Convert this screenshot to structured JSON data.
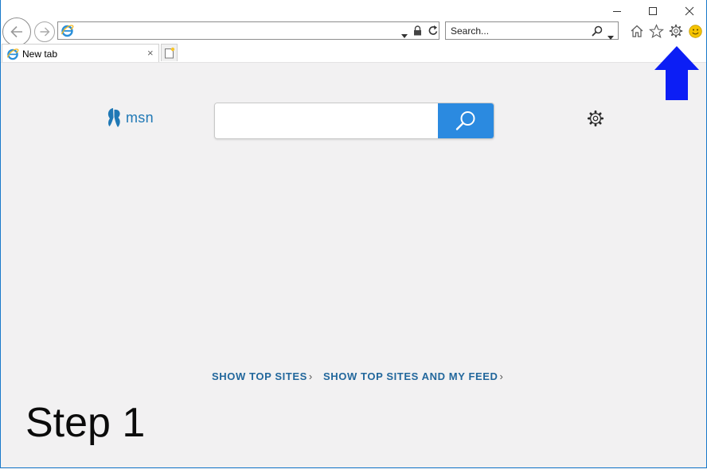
{
  "window": {
    "controls": [
      {
        "name": "minimize",
        "icon": "minimize-icon"
      },
      {
        "name": "maximize",
        "icon": "maximize-icon"
      },
      {
        "name": "close",
        "icon": "close-icon"
      }
    ]
  },
  "toolbar": {
    "address": {
      "value": "",
      "placeholder": ""
    },
    "search": {
      "value": "",
      "placeholder": "Search..."
    },
    "icons": [
      "back-arrow-icon",
      "forward-arrow-icon",
      "ie-logo-icon",
      "dropdown-icon",
      "lock-icon",
      "refresh-icon",
      "search-icon",
      "home-icon",
      "favorites-star-icon",
      "tools-gear-icon",
      "smiley-feedback-icon"
    ]
  },
  "tabs": [
    {
      "label": "New tab",
      "close": "×",
      "active": true
    }
  ],
  "content": {
    "logo_text": "msn",
    "search": {
      "value": "",
      "placeholder": ""
    },
    "links": [
      {
        "label": "SHOW TOP SITES",
        "chevron": "›"
      },
      {
        "label": "SHOW TOP SITES AND MY FEED",
        "chevron": "›"
      }
    ]
  },
  "overlay": {
    "step_label": "Step 1",
    "arrow_color": "#0c1ef5",
    "arrow_direction": "up"
  },
  "colors": {
    "accent": "#2b8ae0",
    "link": "#22679c",
    "window_border": "#1979ca",
    "page_background": "#f2f1f2"
  }
}
